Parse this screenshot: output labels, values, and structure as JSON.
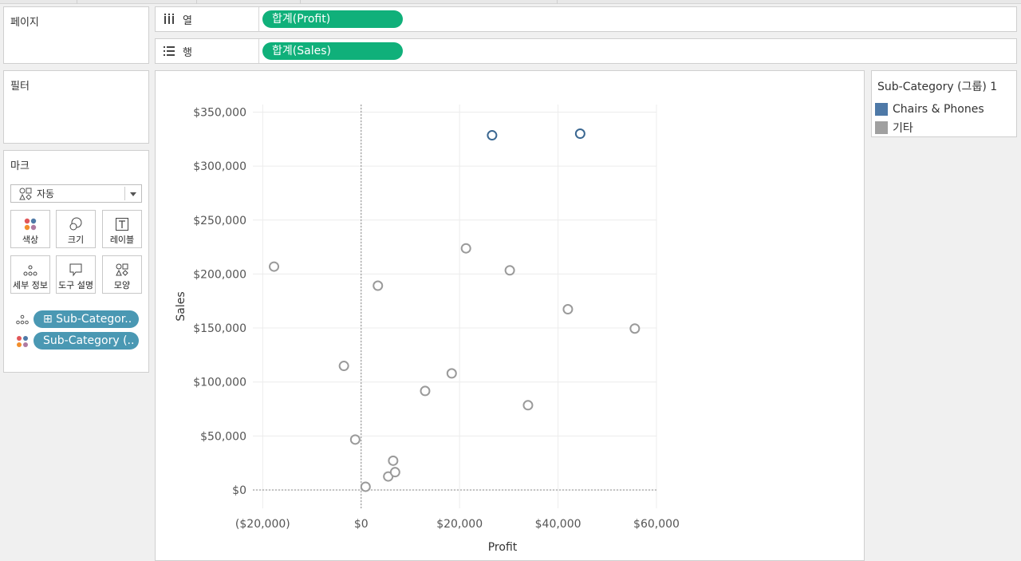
{
  "shelves": {
    "pages": "페이지",
    "filters": "필터",
    "columns": {
      "label": "열",
      "pill": "합계(Profit)"
    },
    "rows": {
      "label": "행",
      "pill": "합계(Sales)"
    }
  },
  "marks": {
    "title": "마크",
    "type": "자동",
    "buttons": {
      "color": "색상",
      "size": "크기",
      "label": "레이블",
      "detail": "세부 정보",
      "tooltip": "도구 설명",
      "shape": "모양"
    },
    "fields": {
      "detail_pill": "⊞ Sub-Categor..",
      "color_pill": "Sub-Category (.."
    }
  },
  "legend": {
    "title": "Sub-Category (그룹) 1",
    "items": [
      {
        "label": "Chairs & Phones",
        "color": "#4e79a7"
      },
      {
        "label": "기타",
        "color": "#a0a0a0"
      }
    ]
  },
  "chart_data": {
    "type": "scatter",
    "xlabel": "Profit",
    "ylabel": "Sales",
    "xlim": [
      -22000,
      60000
    ],
    "ylim": [
      -17000,
      357000
    ],
    "xticks": [
      -20000,
      0,
      20000,
      40000,
      60000
    ],
    "xtick_labels": [
      "($20,000)",
      "$0",
      "$20,000",
      "$40,000",
      "$60,000"
    ],
    "yticks": [
      0,
      50000,
      100000,
      150000,
      200000,
      250000,
      300000,
      350000
    ],
    "ytick_labels": [
      "$0",
      "$50,000",
      "$100,000",
      "$150,000",
      "$200,000",
      "$250,000",
      "$300,000",
      "$350,000"
    ],
    "grid": true,
    "series": [
      {
        "name": "Chairs & Phones",
        "color": "#3a6791",
        "points": [
          [
            26600,
            328500
          ],
          [
            44500,
            330000
          ]
        ]
      },
      {
        "name": "기타",
        "color": "#9a9a9a",
        "points": [
          [
            -17700,
            206900
          ],
          [
            -3500,
            114900
          ],
          [
            -1200,
            46700
          ],
          [
            900,
            3000
          ],
          [
            3400,
            189200
          ],
          [
            5500,
            12500
          ],
          [
            6500,
            27100
          ],
          [
            6900,
            16500
          ],
          [
            13000,
            91700
          ],
          [
            18400,
            108000
          ],
          [
            21300,
            223800
          ],
          [
            30200,
            203400
          ],
          [
            33900,
            78500
          ],
          [
            42000,
            167400
          ],
          [
            55600,
            149500
          ]
        ]
      }
    ]
  }
}
